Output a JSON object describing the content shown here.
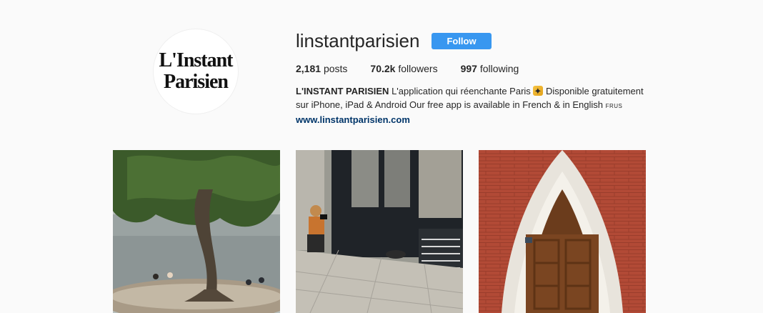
{
  "profile": {
    "avatar_text_line1": "L'Instant",
    "avatar_text_line2": "Parisien",
    "username": "linstantparisien",
    "follow_label": "Follow"
  },
  "stats": {
    "posts_count": "2,181",
    "posts_label": "posts",
    "followers_count": "70.2k",
    "followers_label": "followers",
    "following_count": "997",
    "following_label": "following"
  },
  "bio": {
    "full_name": "L'INSTANT PARISIEN",
    "text_part1": " L'application qui réenchante Paris ",
    "emoji_icon": "sparkle-emoji-icon",
    "text_part2": " Disponible gratuitement sur iPhone, iPad & Android Our free app is available in French & in English ",
    "flags": "FRUS",
    "website": "www.linstantparisien.com"
  },
  "posts": [
    {
      "subject": "tree-by-seine-photo"
    },
    {
      "subject": "photographer-shopfront-photo"
    },
    {
      "subject": "gothic-door-photo"
    }
  ],
  "colors": {
    "follow_button": "#3897f0",
    "link": "#003569",
    "background": "#fafafa"
  }
}
